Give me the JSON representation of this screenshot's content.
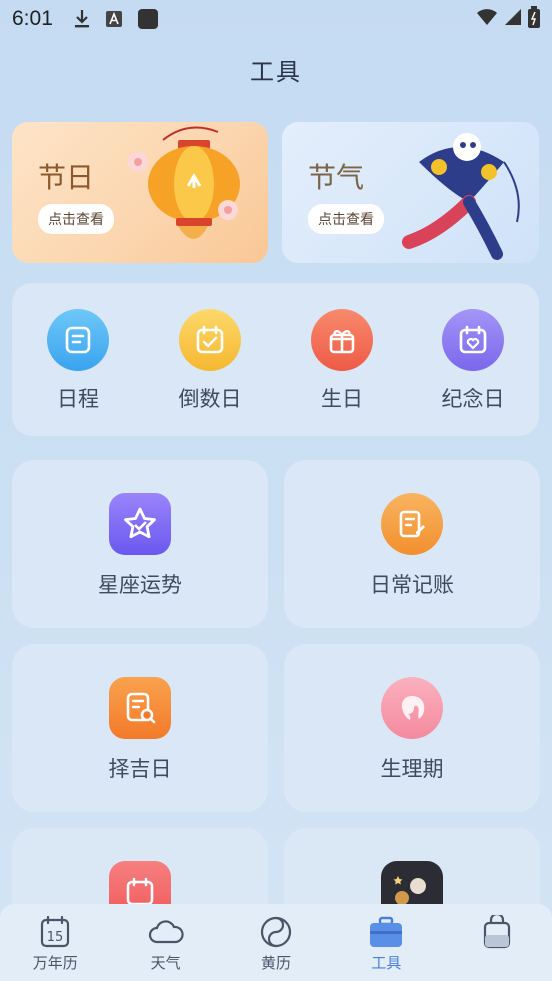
{
  "status_bar": {
    "time": "6:01"
  },
  "header": {
    "title": "工具"
  },
  "banners": [
    {
      "title": "节日",
      "button": "点击查看",
      "accent": "#f7a54a"
    },
    {
      "title": "节气",
      "button": "点击查看",
      "accent": "#5a8fe0"
    }
  ],
  "quick_tools": [
    {
      "label": "日程",
      "icon": "document-icon",
      "color": "#4fb5f3"
    },
    {
      "label": "倒数日",
      "icon": "calendar-check-icon",
      "color": "#f9c44b"
    },
    {
      "label": "生日",
      "icon": "gift-icon",
      "color": "#f47258"
    },
    {
      "label": "纪念日",
      "icon": "calendar-heart-icon",
      "color": "#8b7bf0"
    }
  ],
  "tools": [
    {
      "label": "星座运势",
      "icon": "star-icon",
      "color": "#7b6cf4"
    },
    {
      "label": "日常记账",
      "icon": "notepad-pen-icon",
      "color": "#f6a148"
    },
    {
      "label": "择吉日",
      "icon": "search-document-icon",
      "color": "#f48a3a"
    },
    {
      "label": "生理期",
      "icon": "female-head-icon",
      "color": "#f597a8"
    },
    {
      "label": "",
      "icon": "calendar-icon",
      "color": "#f26363"
    },
    {
      "label": "",
      "icon": "elder-avatar-icon",
      "color": "#2c2c35"
    }
  ],
  "tab_bar": {
    "items": [
      {
        "label": "万年历",
        "icon": "calendar-15-icon",
        "calendar_day": "15"
      },
      {
        "label": "天气",
        "icon": "cloud-icon"
      },
      {
        "label": "黄历",
        "icon": "yin-yang-icon"
      },
      {
        "label": "工具",
        "icon": "toolbox-icon",
        "active": true
      },
      {
        "label": "",
        "icon": "profile-icon"
      }
    ],
    "active_color": "#4a7fd8"
  }
}
